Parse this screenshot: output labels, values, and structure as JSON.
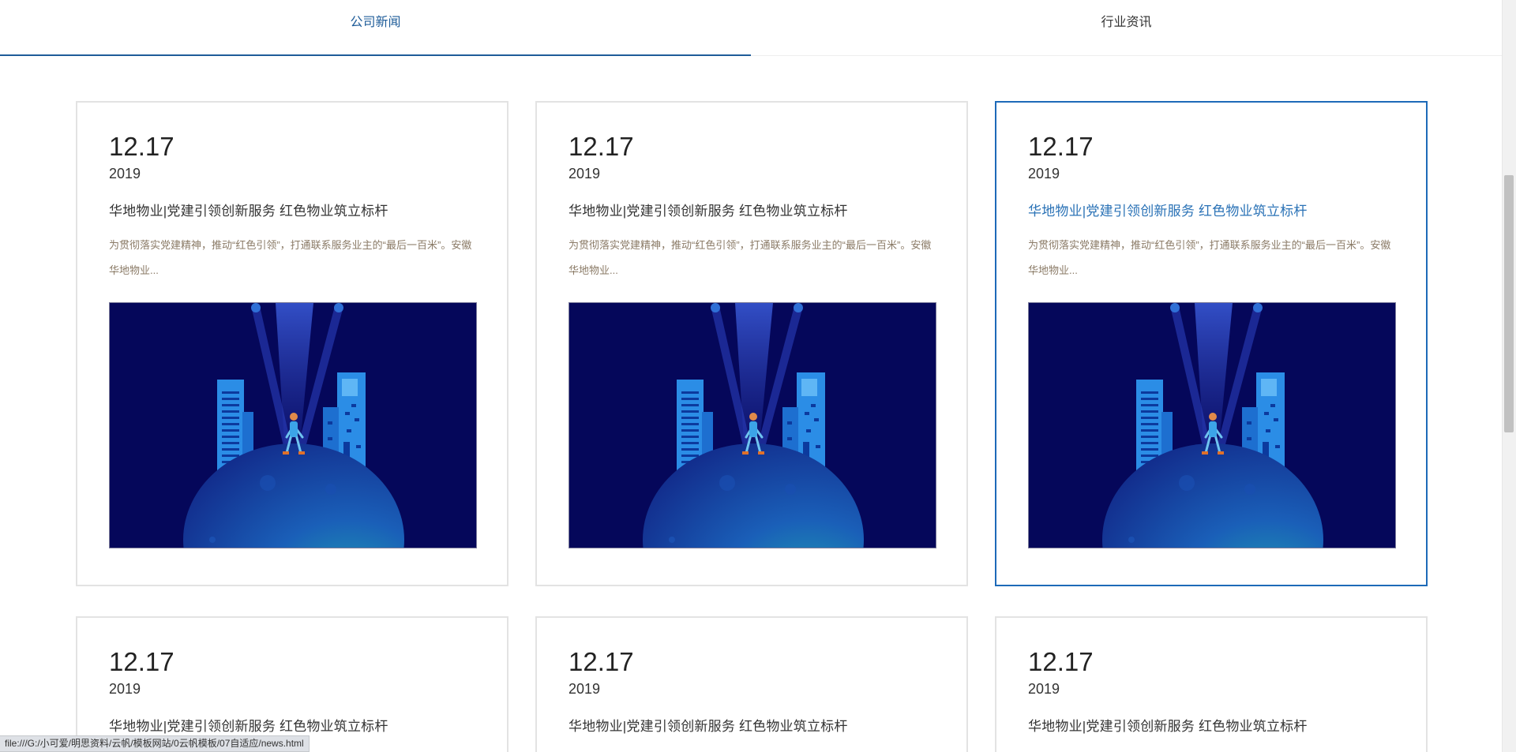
{
  "tabs": [
    {
      "label": "公司新闻",
      "active": true
    },
    {
      "label": "行业资讯",
      "active": false
    }
  ],
  "cards": [
    {
      "date": "12.17",
      "year": "2019",
      "title": "华地物业|党建引领创新服务 红色物业筑立标杆",
      "desc": "为贯彻落实党建精神，推动“红色引领”，打通联系服务业主的“最后一百米”。安徽华地物业..."
    },
    {
      "date": "12.17",
      "year": "2019",
      "title": "华地物业|党建引领创新服务 红色物业筑立标杆",
      "desc": "为贯彻落实党建精神，推动“红色引领”，打通联系服务业主的“最后一百米”。安徽华地物业..."
    },
    {
      "date": "12.17",
      "year": "2019",
      "title": "华地物业|党建引领创新服务 红色物业筑立标杆",
      "desc": "为贯彻落实党建精神，推动“红色引领”，打通联系服务业主的“最后一百米”。安徽华地物业..."
    },
    {
      "date": "12.17",
      "year": "2019",
      "title": "华地物业|党建引领创新服务 红色物业筑立标杆"
    },
    {
      "date": "12.17",
      "year": "2019",
      "title": "华地物业|党建引领创新服务 红色物业筑立标杆"
    },
    {
      "date": "12.17",
      "year": "2019",
      "title": "华地物业|党建引领创新服务 红色物业筑立标杆"
    }
  ],
  "status_url": "file:///G:/小可爱/明思资料/云帆/模板网站/0云帆模板/07自适应/news.html",
  "colors": {
    "accent": "#1e5c99",
    "hover_border": "#1d6ab8",
    "illustration_bg": "#05075a"
  },
  "icons": {
    "illustration": "city-spotlight-illustration"
  }
}
